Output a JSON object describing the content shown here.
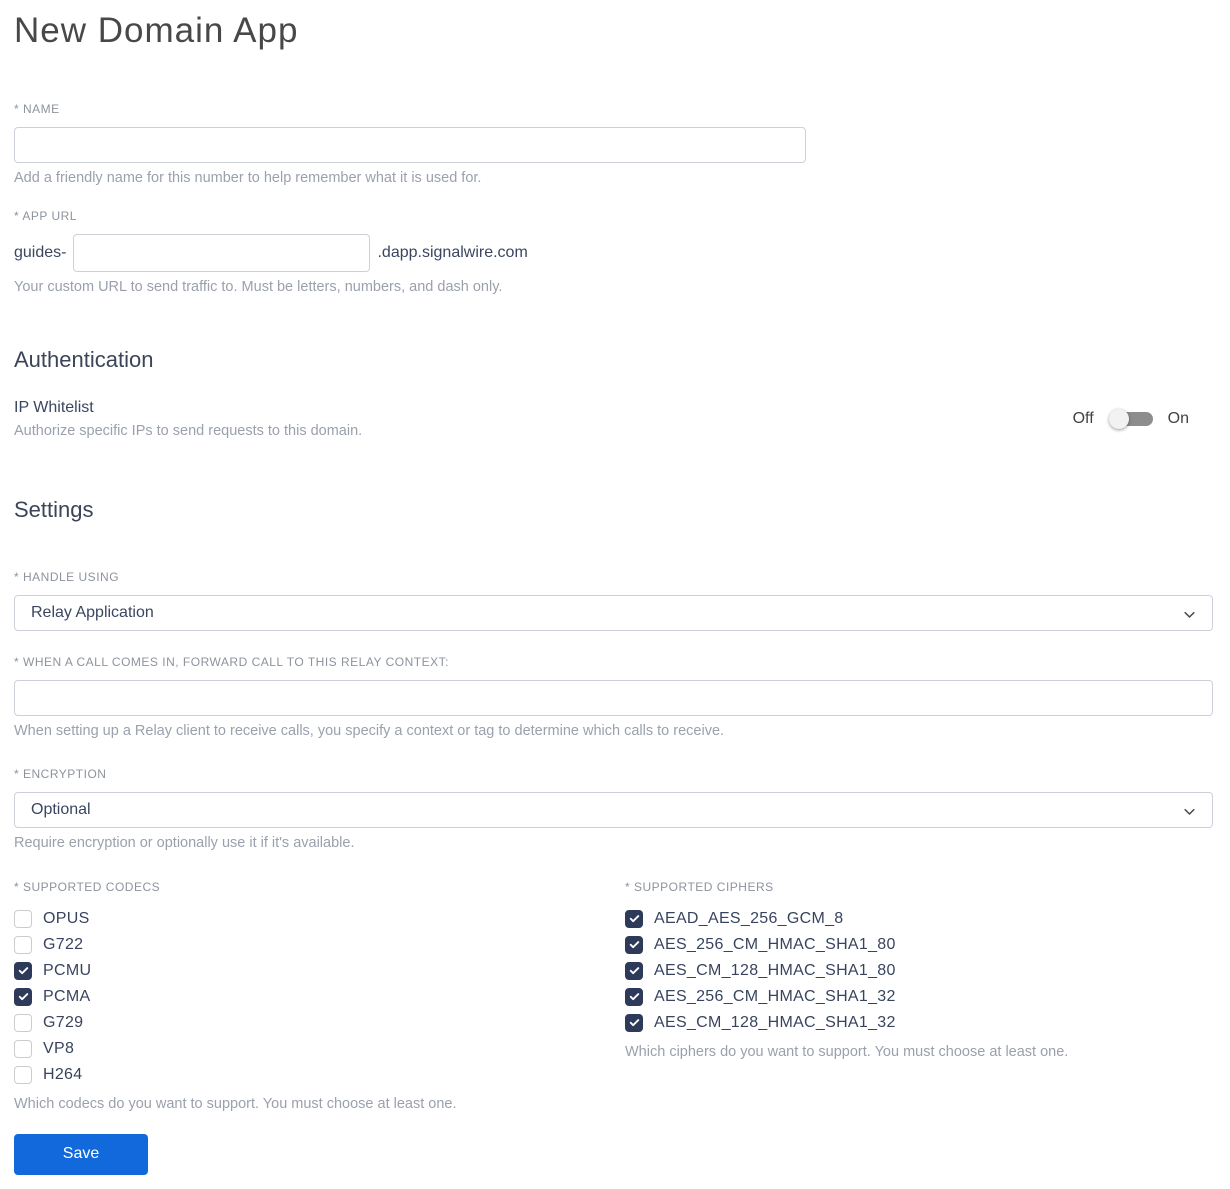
{
  "page": {
    "title": "New Domain App"
  },
  "colors": {
    "accent_blue": "#1169db",
    "checkbox_navy": "#2e3a59"
  },
  "name_field": {
    "label": "* NAME",
    "value": "",
    "helper": "Add a friendly name for this number to help remember what it is used for."
  },
  "app_url_field": {
    "label": "* APP URL",
    "prefix": "guides-",
    "value": "",
    "suffix": ".dapp.signalwire.com",
    "helper": "Your custom URL to send traffic to. Must be letters, numbers, and dash only."
  },
  "authentication": {
    "heading": "Authentication",
    "ip_whitelist": {
      "label": "IP Whitelist",
      "helper": "Authorize specific IPs to send requests to this domain.",
      "off_label": "Off",
      "on_label": "On",
      "state": "off"
    }
  },
  "settings": {
    "heading": "Settings",
    "handle_using": {
      "label": "* HANDLE USING",
      "value": "Relay Application"
    },
    "relay_context": {
      "label": "* WHEN A CALL COMES IN, FORWARD CALL TO THIS RELAY CONTEXT:",
      "value": "",
      "helper": "When setting up a Relay client to receive calls, you specify a context or tag to determine which calls to receive."
    },
    "encryption": {
      "label": "* ENCRYPTION",
      "value": "Optional",
      "helper": "Require encryption or optionally use it if it's available."
    },
    "codecs": {
      "label": "* SUPPORTED CODECS",
      "helper": "Which codecs do you want to support. You must choose at least one.",
      "options": [
        {
          "label": "OPUS",
          "checked": false
        },
        {
          "label": "G722",
          "checked": false
        },
        {
          "label": "PCMU",
          "checked": true
        },
        {
          "label": "PCMA",
          "checked": true
        },
        {
          "label": "G729",
          "checked": false
        },
        {
          "label": "VP8",
          "checked": false
        },
        {
          "label": "H264",
          "checked": false
        }
      ]
    },
    "ciphers": {
      "label": "* SUPPORTED CIPHERS",
      "helper": "Which ciphers do you want to support. You must choose at least one.",
      "options": [
        {
          "label": "AEAD_AES_256_GCM_8",
          "checked": true
        },
        {
          "label": "AES_256_CM_HMAC_SHA1_80",
          "checked": true
        },
        {
          "label": "AES_CM_128_HMAC_SHA1_80",
          "checked": true
        },
        {
          "label": "AES_256_CM_HMAC_SHA1_32",
          "checked": true
        },
        {
          "label": "AES_CM_128_HMAC_SHA1_32",
          "checked": true
        }
      ]
    }
  },
  "save_button": {
    "label": "Save"
  }
}
